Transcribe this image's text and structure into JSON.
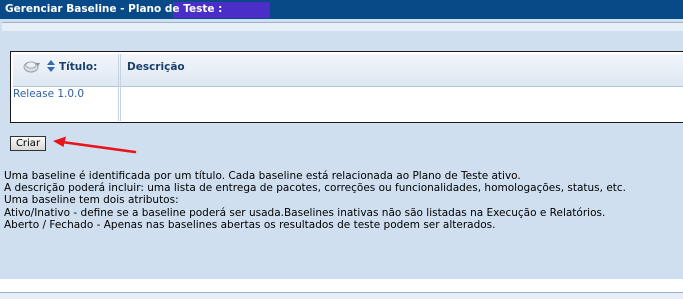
{
  "window": {
    "title": "Gerenciar Baseline - Plano de Teste :",
    "accent": "#084a87",
    "highlight": "#4a2ec7"
  },
  "table": {
    "columns": [
      "Título:",
      "Descrição"
    ],
    "column_icon": "columns-icon",
    "sort_icon": "sort-arrows-icon",
    "rows": [
      {
        "title": "Release 1.0.0",
        "description": ""
      }
    ]
  },
  "actions": {
    "create_label": "Criar",
    "annotation": "red-arrow-icon"
  },
  "help": {
    "lines": [
      "Uma baseline é identificada por um título. Cada baseline está relacionada ao Plano de Teste ativo.",
      "A descrição poderá incluir: uma lista de entrega de pacotes, correções ou funcionalidades, homologações, status, etc.",
      "Uma baseline tem dois atributos:",
      "Ativo/Inativo - define se a baseline poderá ser usada.Baselines inativas não são listadas na Execução e Relatórios.",
      "Aberto / Fechado - Apenas nas baselines abertas os resultados de teste podem ser alterados."
    ]
  }
}
